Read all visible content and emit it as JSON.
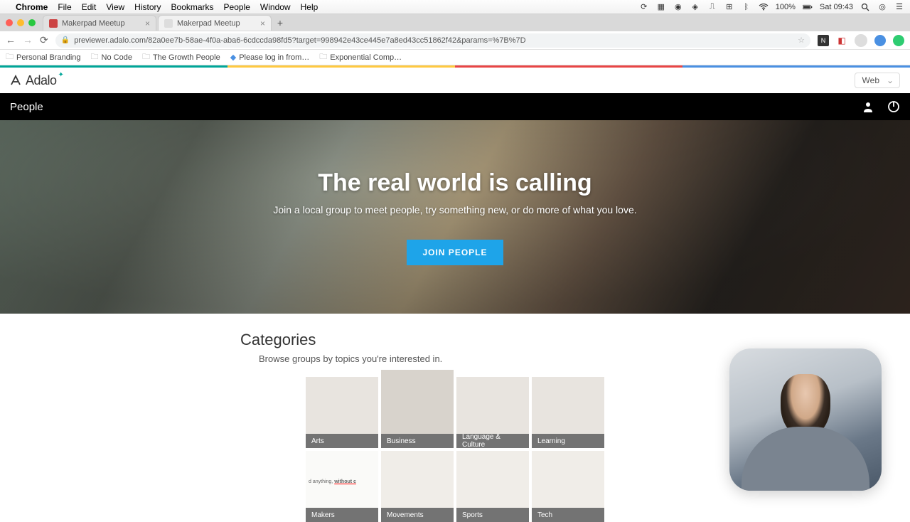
{
  "macmenu": {
    "app": "Chrome",
    "items": [
      "File",
      "Edit",
      "View",
      "History",
      "Bookmarks",
      "People",
      "Window",
      "Help"
    ],
    "battery": "100%",
    "clock": "Sat 09:43"
  },
  "tabs": [
    {
      "title": "Makerpad Meetup",
      "active": false
    },
    {
      "title": "Makerpad Meetup",
      "active": true
    }
  ],
  "url": "previewer.adalo.com/82a0ee7b-58ae-4f0a-aba6-6cdccda98fd5?target=998942e43ce445e7a8ed43cc51862f42&params=%7B%7D",
  "bookmarks": [
    "Personal Branding",
    "No Code",
    "The Growth People",
    "Please log in from…",
    "Exponential Comp…"
  ],
  "adalo": {
    "brand": "Adalo",
    "device": "Web"
  },
  "app": {
    "title": "People"
  },
  "hero": {
    "heading": "The real world is calling",
    "sub": "Join a local group to meet people, try something new, or do more of what you love.",
    "cta": "JOIN PEOPLE"
  },
  "categories": {
    "heading": "Categories",
    "sub": "Browse groups by topics you're interested in.",
    "row1": [
      "Arts",
      "Business",
      "Language & Culture",
      "Learning"
    ],
    "row2": [
      "Makers",
      "Movements",
      "Sports",
      "Tech"
    ]
  }
}
